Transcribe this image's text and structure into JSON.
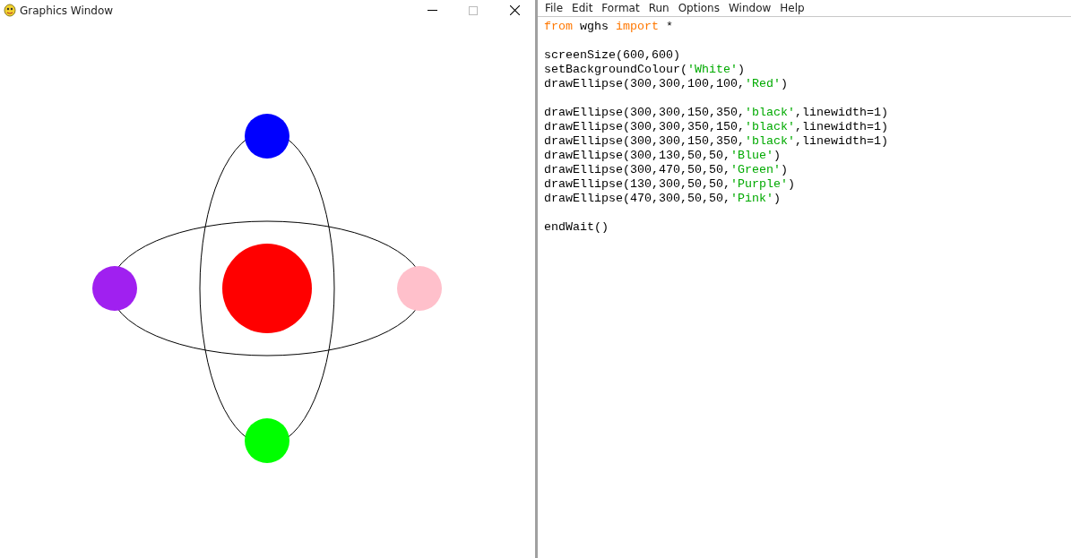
{
  "graphics_window": {
    "title": "Graphics Window"
  },
  "editor": {
    "menu": [
      "File",
      "Edit",
      "Format",
      "Run",
      "Options",
      "Window",
      "Help"
    ],
    "lines": [
      {
        "kind": "code",
        "tokens": [
          {
            "kind": "keyword",
            "text": "from"
          },
          {
            "kind": "plain",
            "text": " wghs "
          },
          {
            "kind": "keyword",
            "text": "import"
          },
          {
            "kind": "plain",
            "text": " *"
          }
        ]
      },
      {
        "kind": "blank"
      },
      {
        "kind": "code",
        "tokens": [
          {
            "kind": "plain",
            "text": "screenSize(600,600)"
          }
        ]
      },
      {
        "kind": "code",
        "tokens": [
          {
            "kind": "plain",
            "text": "setBackgroundColour("
          },
          {
            "kind": "string",
            "text": "'White'"
          },
          {
            "kind": "plain",
            "text": ")"
          }
        ]
      },
      {
        "kind": "code",
        "tokens": [
          {
            "kind": "plain",
            "text": "drawEllipse(300,300,100,100,"
          },
          {
            "kind": "string",
            "text": "'Red'"
          },
          {
            "kind": "plain",
            "text": ")"
          }
        ]
      },
      {
        "kind": "blank"
      },
      {
        "kind": "code",
        "tokens": [
          {
            "kind": "plain",
            "text": "drawEllipse(300,300,150,350,"
          },
          {
            "kind": "string",
            "text": "'black'"
          },
          {
            "kind": "plain",
            "text": ",linewidth=1)"
          }
        ]
      },
      {
        "kind": "code",
        "tokens": [
          {
            "kind": "plain",
            "text": "drawEllipse(300,300,350,150,"
          },
          {
            "kind": "string",
            "text": "'black'"
          },
          {
            "kind": "plain",
            "text": ",linewidth=1)"
          }
        ]
      },
      {
        "kind": "code",
        "tokens": [
          {
            "kind": "plain",
            "text": "drawEllipse(300,300,150,350,"
          },
          {
            "kind": "string",
            "text": "'black'"
          },
          {
            "kind": "plain",
            "text": ",linewidth=1)"
          }
        ]
      },
      {
        "kind": "code",
        "tokens": [
          {
            "kind": "plain",
            "text": "drawEllipse(300,130,50,50,"
          },
          {
            "kind": "string",
            "text": "'Blue'"
          },
          {
            "kind": "plain",
            "text": ")"
          }
        ]
      },
      {
        "kind": "code",
        "tokens": [
          {
            "kind": "plain",
            "text": "drawEllipse(300,470,50,50,"
          },
          {
            "kind": "string",
            "text": "'Green'"
          },
          {
            "kind": "plain",
            "text": ")"
          }
        ]
      },
      {
        "kind": "code",
        "tokens": [
          {
            "kind": "plain",
            "text": "drawEllipse(130,300,50,50,"
          },
          {
            "kind": "string",
            "text": "'Purple'"
          },
          {
            "kind": "plain",
            "text": ")"
          }
        ]
      },
      {
        "kind": "code",
        "tokens": [
          {
            "kind": "plain",
            "text": "drawEllipse(470,300,50,50,"
          },
          {
            "kind": "string",
            "text": "'Pink'"
          },
          {
            "kind": "plain",
            "text": ")"
          }
        ]
      },
      {
        "kind": "blank"
      },
      {
        "kind": "code",
        "tokens": [
          {
            "kind": "plain",
            "text": "endWait()"
          }
        ]
      }
    ]
  }
}
